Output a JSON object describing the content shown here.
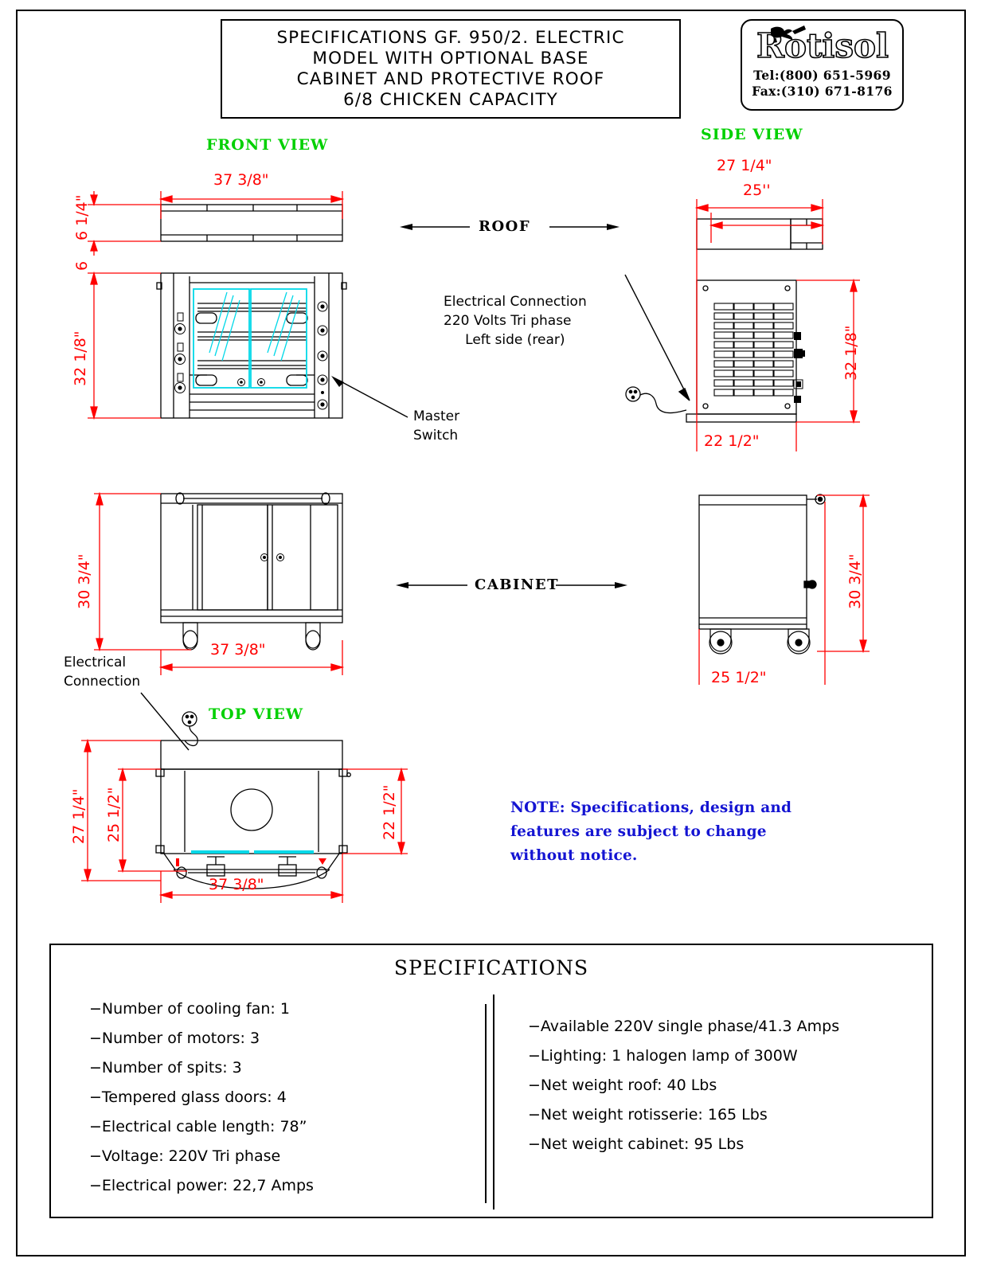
{
  "title_block": {
    "lines": [
      "SPECIFICATIONS GF. 950/2. ELECTRIC",
      "MODEL WITH OPTIONAL BASE",
      "CABINET AND PROTECTIVE ROOF",
      "6/8 CHICKEN CAPACITY"
    ]
  },
  "logo": {
    "brand": "Rotisol",
    "tel": "Tel:(800) 651-5969",
    "fax": "Fax:(310) 671-8176"
  },
  "view_labels": {
    "front": "FRONT VIEW",
    "side": "SIDE VIEW",
    "top": "TOP  VIEW"
  },
  "section_labels": {
    "roof": "ROOF",
    "cabinet": "CABINET"
  },
  "annotations": {
    "electrical_connection": {
      "line1": "Electrical Connection",
      "line2": "220 Volts Tri phase",
      "line3": "Left side (rear)"
    },
    "master_switch": {
      "line1": "Master",
      "line2": "Switch"
    },
    "cabinet_electrical": {
      "line1": "Electrical",
      "line2": "Connection"
    }
  },
  "dimensions": {
    "front_roof_width": "37 3/8\"",
    "front_roof_h_top": "6 1/4\"",
    "front_roof_h_bot": "6",
    "front_body_height": "32 1/8\"",
    "side_roof_depth_outer": "27 1/4\"",
    "side_roof_depth_inner": "25''",
    "side_body_height": "32 1/8\"",
    "side_body_depth": "22 1/2\"",
    "cabinet_front_height": "30 3/4\"",
    "cabinet_front_width": "37 3/8\"",
    "cabinet_side_height": "30 3/4\"",
    "cabinet_side_depth": "25 1/2\"",
    "top_depth_outer": "27 1/4\"",
    "top_depth_mid": "25 1/2\"",
    "top_depth_right": "22 1/2\"",
    "top_width": "37 3/8\""
  },
  "note": {
    "lines": [
      "NOTE: Specifications, design and",
      "features are subject to change",
      "without notice."
    ]
  },
  "specifications": {
    "title": "SPECIFICATIONS",
    "left_column": [
      "−Number of cooling fan: 1",
      "−Number of motors: 3",
      "−Number of spits: 3",
      "−Tempered glass doors: 4",
      "−Electrical cable length: 78”",
      "−Voltage: 220V Tri phase",
      "−Electrical power: 22,7 Amps"
    ],
    "right_column": [
      "−Available 220V single phase/41.3 Amps",
      "−Lighting: 1 halogen lamp of 300W",
      "−Net weight roof: 40 Lbs",
      "−Net weight rotisserie: 165 Lbs",
      "−Net weight cabinet: 95 Lbs"
    ]
  },
  "colors": {
    "dimension_red": "#FF0000",
    "view_label_green": "#00D000",
    "note_blue": "#1414D2",
    "glass_cyan": "#00D8E8",
    "outline_black": "#000000"
  }
}
